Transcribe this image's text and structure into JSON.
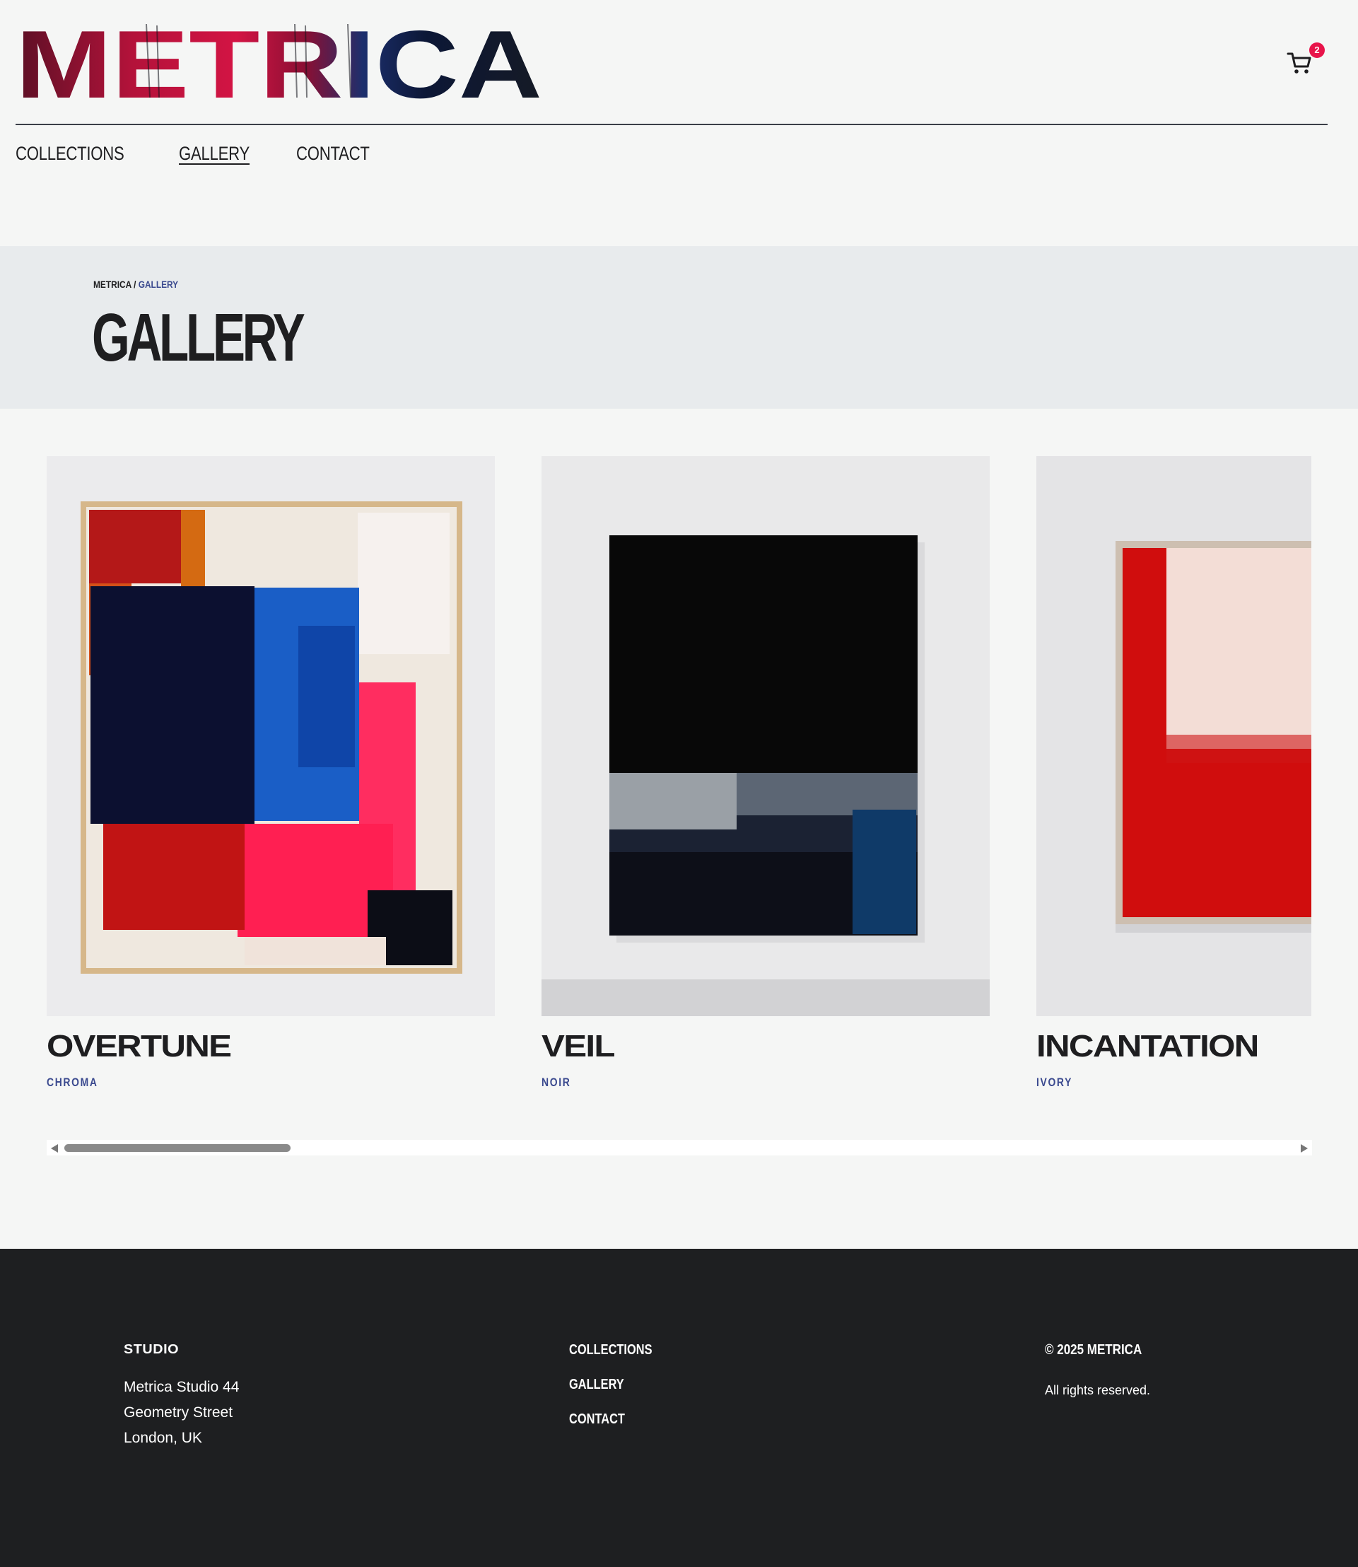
{
  "brand": {
    "name": "METRICA"
  },
  "cart": {
    "count": "2"
  },
  "nav": {
    "items": [
      {
        "label": "COLLECTIONS"
      },
      {
        "label": "GALLERY"
      },
      {
        "label": "CONTACT"
      }
    ]
  },
  "breadcrumb": {
    "root": "METRICA",
    "separator": " / ",
    "current": "GALLERY"
  },
  "hero": {
    "title": "GALLERY"
  },
  "gallery": {
    "items": [
      {
        "title": "OVERTUNE",
        "collection": "CHROMA"
      },
      {
        "title": "VEIL",
        "collection": "NOIR"
      },
      {
        "title": "INCANTATION",
        "collection": "IVORY"
      }
    ]
  },
  "footer": {
    "studio_heading": "STUDIO",
    "address": "Metrica Studio 44 Geometry Street London, UK",
    "links": [
      {
        "label": "COLLECTIONS"
      },
      {
        "label": "GALLERY"
      },
      {
        "label": "CONTACT"
      }
    ],
    "copyright": "© 2025 METRICA",
    "rights": "All rights reserved."
  },
  "colors": {
    "background": "#f5f6f5",
    "hero_band": "#e8ebed",
    "footer": "#1e1f21",
    "accent_blue": "#3b4a8f",
    "badge": "#e8144a"
  },
  "icons": {
    "cart": "cart-icon",
    "scroll_left": "arrow-left-icon",
    "scroll_right": "arrow-right-icon"
  }
}
